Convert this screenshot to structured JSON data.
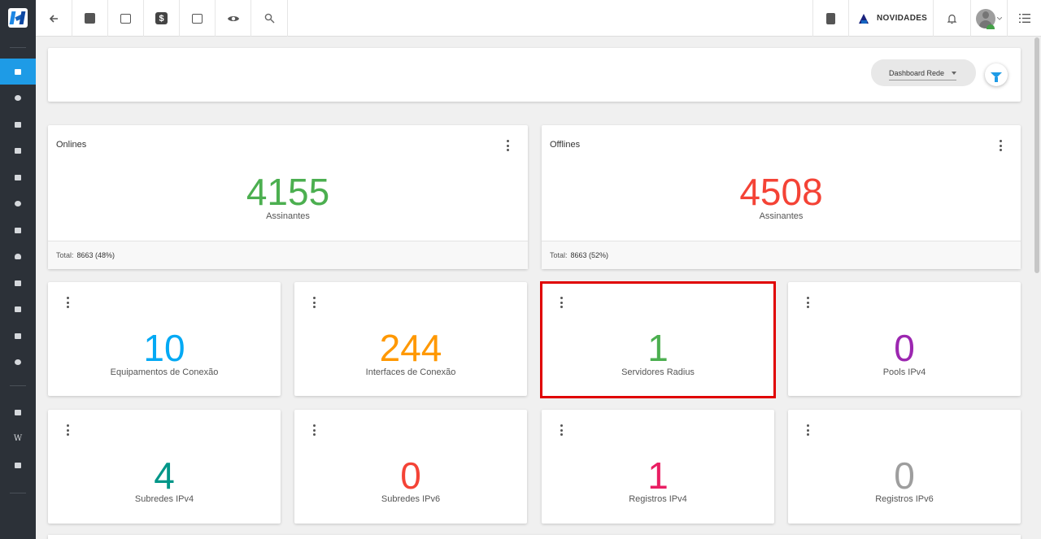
{
  "topbar": {
    "novidades_label": "NOVIDADES",
    "dollar_glyph": "$"
  },
  "filter": {
    "dashboard_select_value": "Dashboard Rede"
  },
  "status_cards": {
    "onlines": {
      "title": "Onlines",
      "value": "4155",
      "label": "Assinantes",
      "total_label": "Total:",
      "total_value": "8663 (48%)",
      "color": "#4caf50"
    },
    "offlines": {
      "title": "Offlines",
      "value": "4508",
      "label": "Assinantes",
      "total_label": "Total:",
      "total_value": "8663 (52%)",
      "color": "#f44336"
    }
  },
  "metric_cards": [
    {
      "value": "10",
      "label": "Equipamentos de Conexão",
      "color": "#03a9f4"
    },
    {
      "value": "244",
      "label": "Interfaces de Conexão",
      "color": "#ff9800"
    },
    {
      "value": "1",
      "label": "Servidores Radius",
      "color": "#4caf50"
    },
    {
      "value": "0",
      "label": "Pools IPv4",
      "color": "#9c27b0"
    },
    {
      "value": "4",
      "label": "Subredes IPv4",
      "color": "#009688"
    },
    {
      "value": "0",
      "label": "Subredes IPv6",
      "color": "#f44336"
    },
    {
      "value": "1",
      "label": "Registros IPv4",
      "color": "#e91e63"
    },
    {
      "value": "0",
      "label": "Registros IPv6",
      "color": "#9e9e9e"
    }
  ],
  "sidebar": {
    "active_color": "#1e9be6",
    "wiki_glyph": "W"
  }
}
